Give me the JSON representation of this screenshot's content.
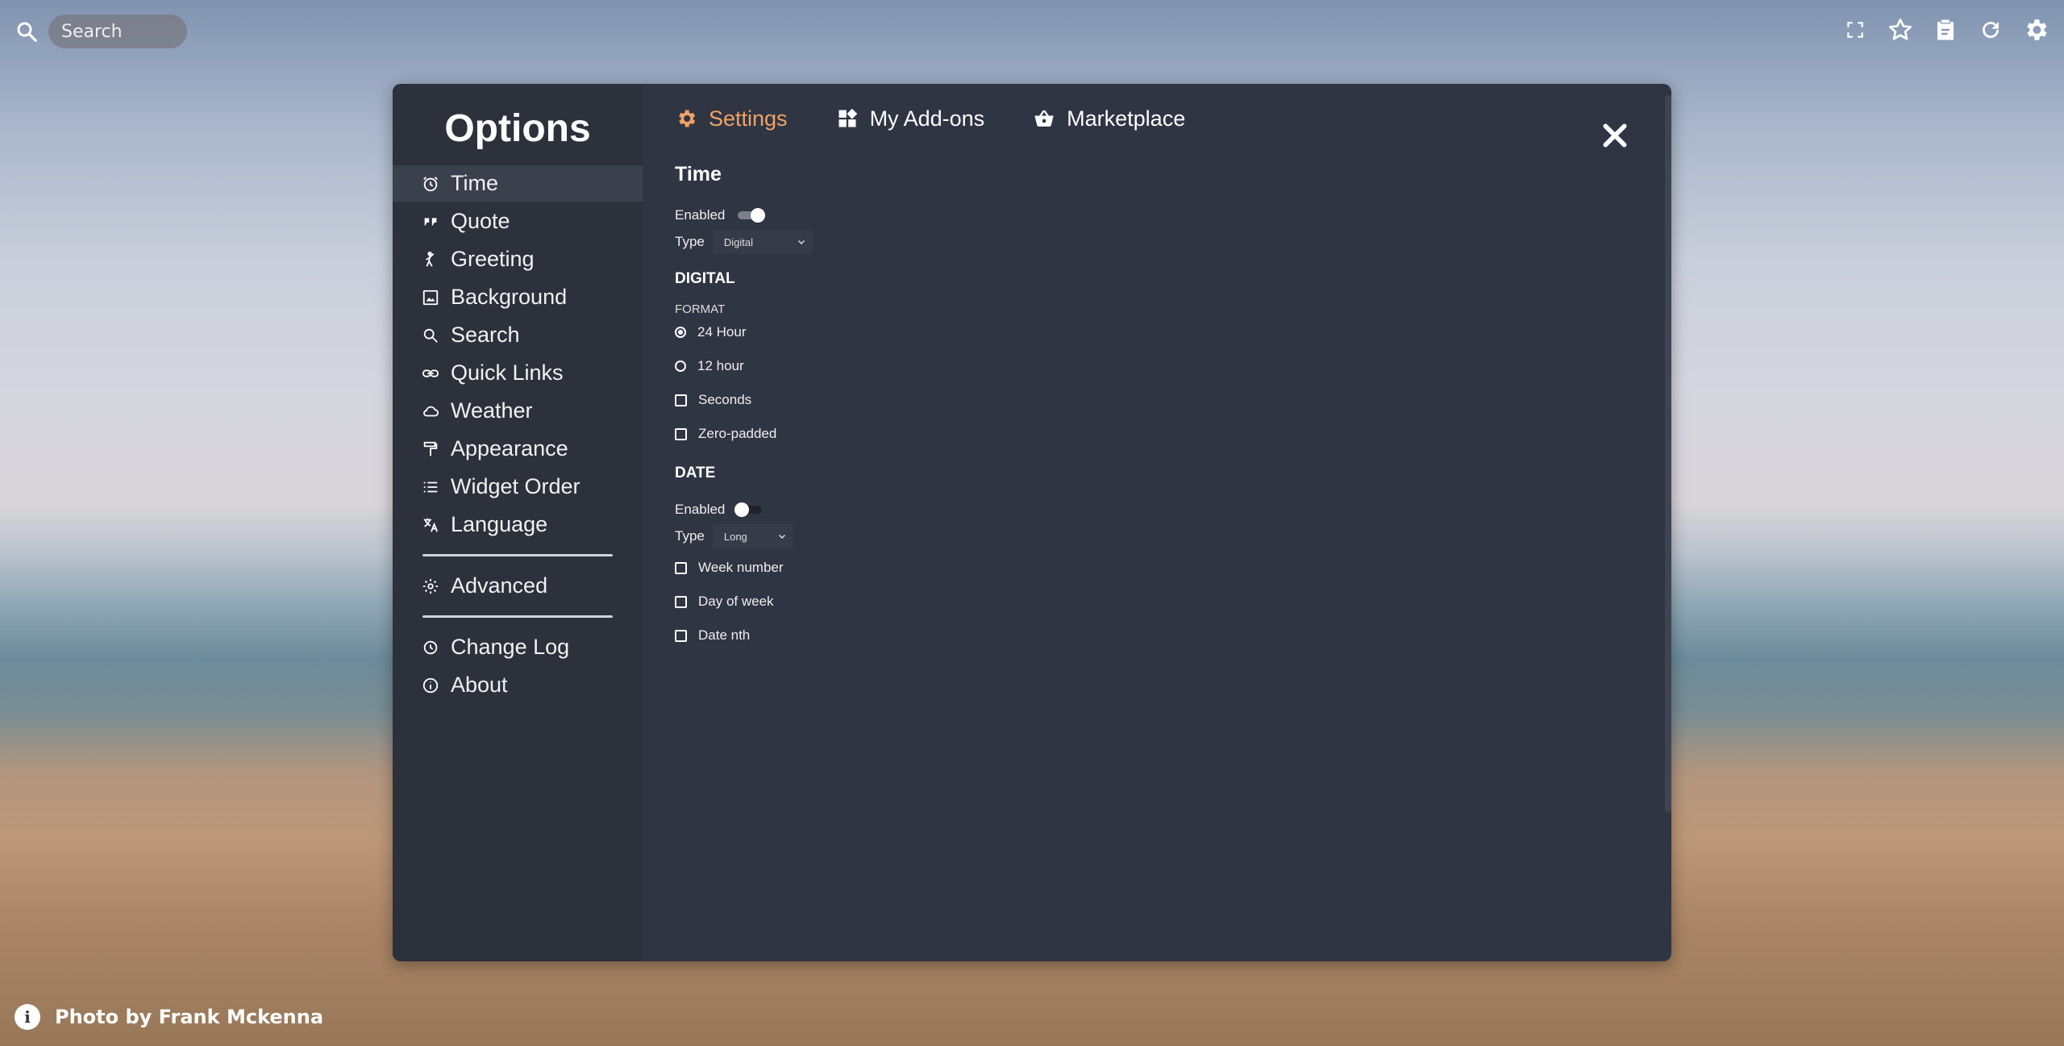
{
  "topbar": {
    "search_placeholder": "Search"
  },
  "footer": {
    "photo_credit": "Photo by Frank Mckenna",
    "info_icon": "i"
  },
  "sidebar": {
    "title": "Options",
    "items": [
      {
        "label": "Time",
        "icon": "alarm-clock-icon"
      },
      {
        "label": "Quote",
        "icon": "quote-icon"
      },
      {
        "label": "Greeting",
        "icon": "waving-person-icon"
      },
      {
        "label": "Background",
        "icon": "image-icon"
      },
      {
        "label": "Search",
        "icon": "search-icon"
      },
      {
        "label": "Quick Links",
        "icon": "link-icon"
      },
      {
        "label": "Weather",
        "icon": "cloud-icon"
      },
      {
        "label": "Appearance",
        "icon": "paint-roller-icon"
      },
      {
        "label": "Widget Order",
        "icon": "list-icon"
      },
      {
        "label": "Language",
        "icon": "translate-icon"
      },
      {
        "label": "Advanced",
        "icon": "gear-icon"
      },
      {
        "label": "Change Log",
        "icon": "history-icon"
      },
      {
        "label": "About",
        "icon": "info-icon"
      }
    ]
  },
  "tabs": [
    {
      "label": "Settings",
      "active": true
    },
    {
      "label": "My Add-ons",
      "active": false
    },
    {
      "label": "Marketplace",
      "active": false
    }
  ],
  "time": {
    "title": "Time",
    "enabled_label": "Enabled",
    "enabled": true,
    "type_label": "Type",
    "type_value": "Digital",
    "digital": {
      "heading": "DIGITAL",
      "format_heading": "FORMAT",
      "options": [
        {
          "label": "24 Hour",
          "kind": "radio",
          "checked": true
        },
        {
          "label": "12 hour",
          "kind": "radio",
          "checked": false
        },
        {
          "label": "Seconds",
          "kind": "checkbox",
          "checked": false
        },
        {
          "label": "Zero-padded",
          "kind": "checkbox",
          "checked": false
        }
      ]
    },
    "date": {
      "heading": "DATE",
      "enabled_label": "Enabled",
      "enabled": false,
      "type_label": "Type",
      "type_value": "Long",
      "options": [
        {
          "label": "Week number",
          "checked": false
        },
        {
          "label": "Day of week",
          "checked": false
        },
        {
          "label": "Date nth",
          "checked": false
        }
      ]
    }
  },
  "colors": {
    "accent": "#f0a267",
    "modal_bg": "#2f3542",
    "sidebar_bg": "#2c313b"
  }
}
